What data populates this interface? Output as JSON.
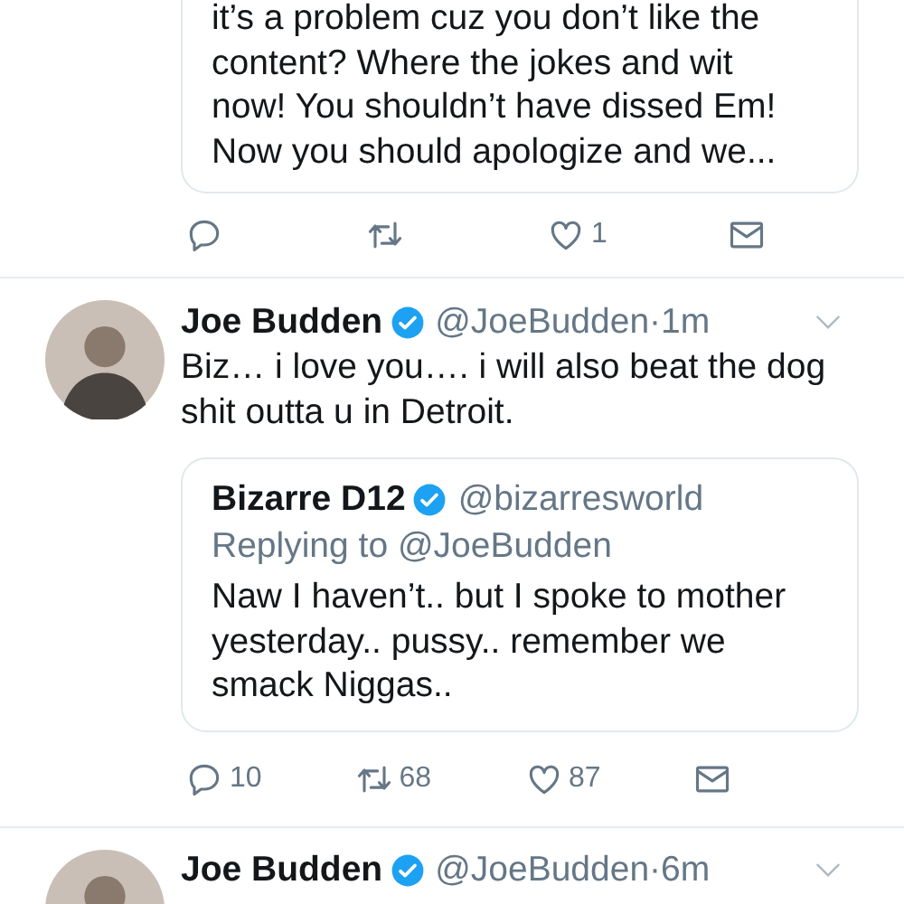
{
  "top_quote": {
    "lines": [
      "it’s a problem cuz you don’t like the",
      "content? Where the jokes and wit",
      "now! You shouldn’t have dissed Em!",
      "Now you should apologize and we..."
    ]
  },
  "top_actions": [
    {
      "kind": "reply"
    },
    {
      "kind": "retweet"
    },
    {
      "kind": "like",
      "count": "1"
    },
    {
      "kind": "message"
    }
  ],
  "tweets": [
    {
      "name": "Joe Budden",
      "verified": true,
      "handle_time": "@JoeBudden·1m",
      "lines": [
        "Biz… i love you…. i will also beat the dog",
        "shit outta u in Detroit."
      ],
      "quote": {
        "name": "Bizarre D12",
        "verified": true,
        "handle": "@bizarresworld",
        "replying_to": "Replying to @JoeBudden",
        "lines": [
          "Naw I haven’t.. but I spoke to mother",
          "yesterday.. pussy.. remember we",
          "smack Niggas.."
        ]
      },
      "actions": [
        {
          "kind": "reply",
          "count": "10"
        },
        {
          "kind": "retweet",
          "count": "68"
        },
        {
          "kind": "like",
          "count": "87"
        },
        {
          "kind": "message"
        }
      ]
    },
    {
      "name": "Joe Budden",
      "verified": true,
      "handle_time": "@JoeBudden·6m"
    }
  ]
}
